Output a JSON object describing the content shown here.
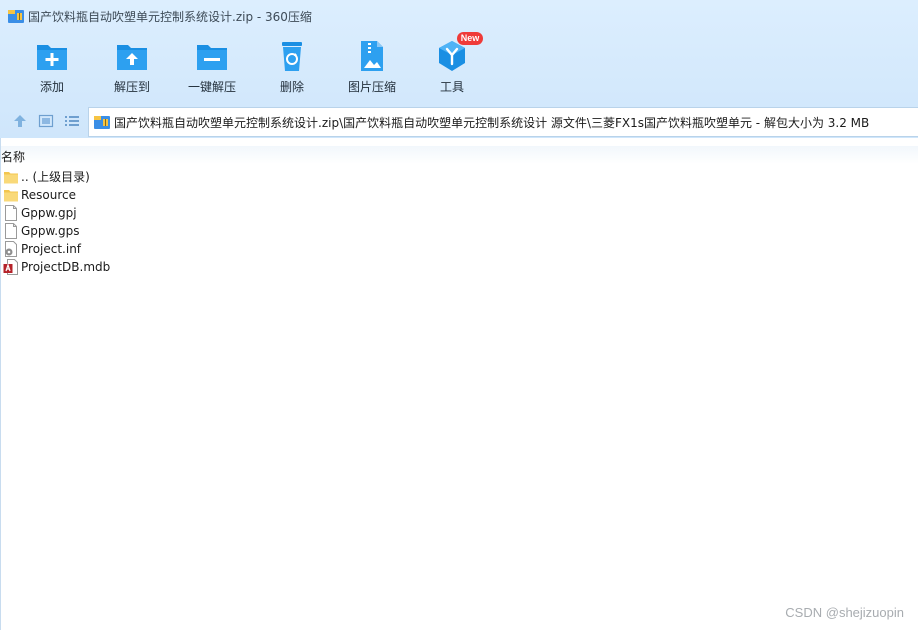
{
  "window": {
    "title": "国产饮料瓶自动吹塑单元控制系统设计.zip - 360压缩",
    "app_icon": "archive-icon"
  },
  "toolbar": {
    "items": [
      {
        "label": "添加",
        "icon": "add-folder-icon"
      },
      {
        "label": "解压到",
        "icon": "extract-folder-icon"
      },
      {
        "label": "一键解压",
        "icon": "quick-extract-icon"
      },
      {
        "label": "删除",
        "icon": "recycle-bin-icon"
      },
      {
        "label": "图片压缩",
        "icon": "image-compress-icon"
      },
      {
        "label": "工具",
        "icon": "tools-cube-icon",
        "badge": "New"
      }
    ]
  },
  "address": {
    "path": "国产饮料瓶自动吹塑单元控制系统设计.zip\\国产饮料瓶自动吹塑单元控制系统设计 源文件\\三菱FX1s国产饮料瓶吹塑单元 - 解包大小为 3.2 MB",
    "nav": [
      "up-arrow-icon",
      "view-icon",
      "list-view-icon"
    ]
  },
  "list": {
    "column_name": "名称",
    "rows": [
      {
        "name": ".. (上级目录)",
        "icon": "folder-icon"
      },
      {
        "name": "Resource",
        "icon": "folder-icon"
      },
      {
        "name": "Gppw.gpj",
        "icon": "file-icon"
      },
      {
        "name": "Gppw.gps",
        "icon": "file-icon"
      },
      {
        "name": "Project.inf",
        "icon": "settings-file-icon"
      },
      {
        "name": "ProjectDB.mdb",
        "icon": "access-db-icon"
      }
    ]
  },
  "watermark": "CSDN @shejizuopin",
  "colors": {
    "accent": "#1a8fe3",
    "chrome_bg": "#d6eafd",
    "folder": "#f9d979",
    "badge": "#ef3b39"
  }
}
